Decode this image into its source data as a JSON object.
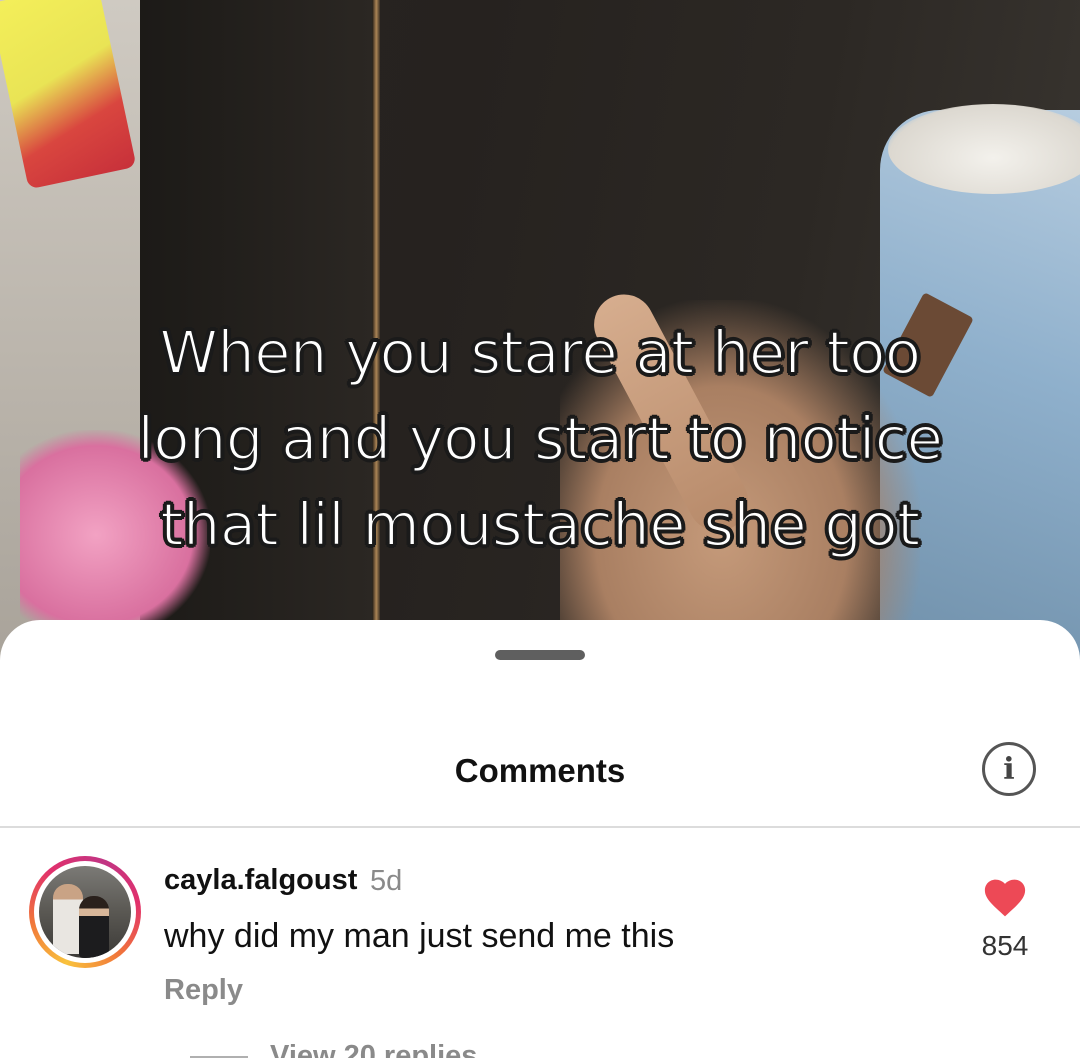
{
  "video": {
    "caption_lines": [
      "When you stare at her too",
      "long and you start to notice",
      "that lil moustache she got"
    ]
  },
  "sheet": {
    "title": "Comments"
  },
  "comments": [
    {
      "username": "cayla.falgoust",
      "time": "5d",
      "text": "why did my man just send me this",
      "reply_label": "Reply",
      "like_count": "854",
      "liked": true,
      "view_replies_label": "View 20 replies"
    }
  ],
  "colors": {
    "like_red": "#ed4956",
    "story_ring": "#e1306c"
  },
  "icons": {
    "info": "info-icon",
    "like": "heart-icon"
  }
}
